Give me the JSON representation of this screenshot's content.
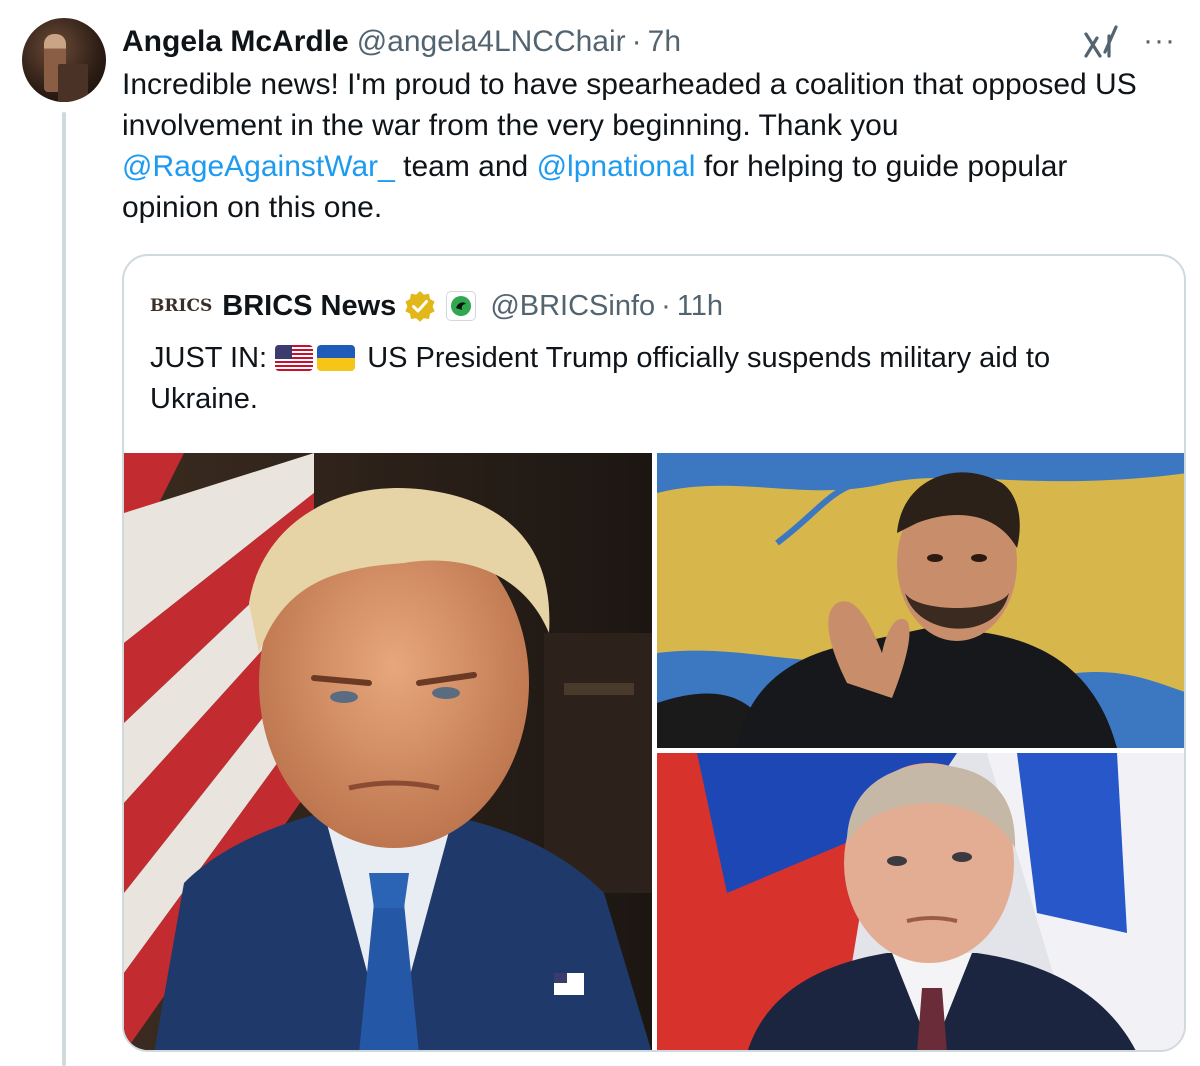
{
  "post": {
    "display_name": "Angela McArdle",
    "handle": "@angela4LNCChair",
    "separator": "·",
    "time": "7h",
    "more_label": "···",
    "text": {
      "part1": "Incredible news! I'm proud to have spearheaded a coalition that opposed US involvement in the war from the very beginning. Thank you ",
      "mention1": "@RageAgainstWar_",
      "part2": " team and ",
      "mention2": "@lpnational",
      "part3": " for helping to guide popular opinion on this one."
    }
  },
  "quote": {
    "logo_text": "BRICS",
    "display_name": "BRICS News",
    "handle": "@BRICSinfo",
    "separator": "·",
    "time": "11h",
    "text": {
      "prefix": "JUST IN: ",
      "flags": [
        "us-flag-icon",
        "ukraine-flag-icon"
      ],
      "body": " US President Trump officially suspends military aid to Ukraine."
    },
    "images": [
      "trump-portrait-image",
      "zelensky-photo-image",
      "putin-photo-image"
    ]
  },
  "colors": {
    "link": "#1d9bf0",
    "text": "#0f1419",
    "secondary": "#536471",
    "border": "#cfd9de",
    "verified": "#e2b719"
  }
}
